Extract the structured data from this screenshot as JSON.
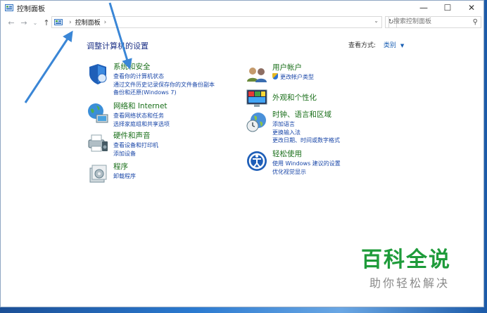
{
  "window": {
    "title": "控制面板"
  },
  "address": {
    "crumb": "控制面板"
  },
  "search": {
    "placeholder": "搜索控制面板"
  },
  "page": {
    "heading": "调整计算机的设置",
    "view_by_label": "查看方式:",
    "view_by_value": "类别"
  },
  "categories_left": [
    {
      "title": "系统和安全",
      "icon": "shield-icon",
      "links": [
        "查看你的计算机状态",
        "通过文件历史记录保存你的文件备份副本",
        "备份和还原(Windows 7)"
      ]
    },
    {
      "title": "网络和 Internet",
      "icon": "globe-network-icon",
      "links": [
        "查看网络状态和任务",
        "选择家庭组和共享选项"
      ]
    },
    {
      "title": "硬件和声音",
      "icon": "printer-speaker-icon",
      "links": [
        "查看设备和打印机",
        "添加设备"
      ]
    },
    {
      "title": "程序",
      "icon": "programs-icon",
      "links": [
        "卸载程序"
      ]
    }
  ],
  "categories_right": [
    {
      "title": "用户帐户",
      "icon": "users-icon",
      "links": [
        "更改帐户类型"
      ]
    },
    {
      "title": "外观和个性化",
      "icon": "appearance-icon",
      "links": []
    },
    {
      "title": "时钟、语言和区域",
      "icon": "clock-globe-icon",
      "links": [
        "添加语言",
        "更换输入法",
        "更改日期、时间或数字格式"
      ]
    },
    {
      "title": "轻松使用",
      "icon": "ease-of-access-icon",
      "links": [
        "使用 Windows 建议的设置",
        "优化视觉显示"
      ]
    }
  ],
  "watermark": {
    "line1": "百科全说",
    "line2": "助你轻松解决"
  }
}
